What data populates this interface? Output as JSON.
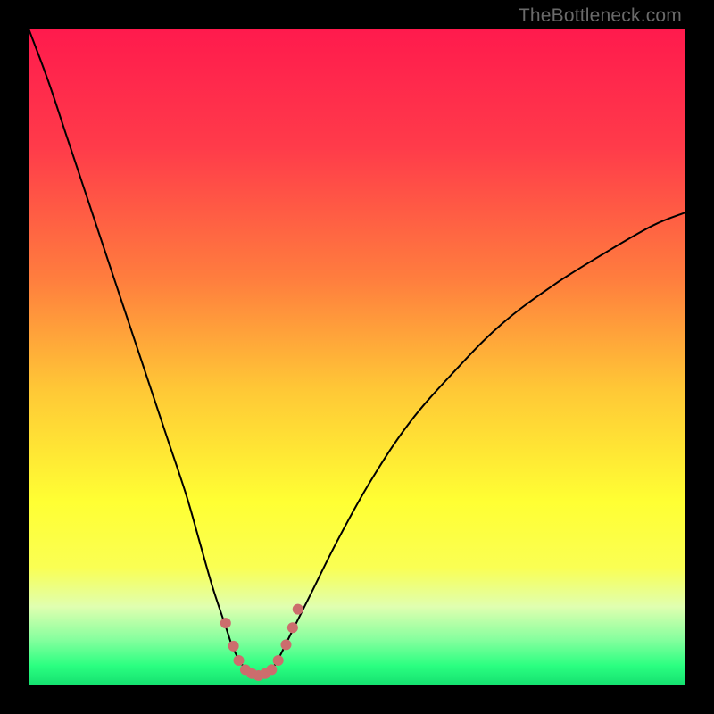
{
  "watermark": "TheBottleneck.com",
  "chart_data": {
    "type": "line",
    "title": "",
    "xlabel": "",
    "ylabel": "",
    "xlim": [
      0,
      100
    ],
    "ylim": [
      0,
      100
    ],
    "grid": false,
    "legend": false,
    "gradient_stops": [
      {
        "offset": 0.0,
        "color": "#ff1a4d"
      },
      {
        "offset": 0.18,
        "color": "#ff3b4a"
      },
      {
        "offset": 0.38,
        "color": "#ff7d3e"
      },
      {
        "offset": 0.55,
        "color": "#ffc836"
      },
      {
        "offset": 0.72,
        "color": "#ffff33"
      },
      {
        "offset": 0.82,
        "color": "#faff53"
      },
      {
        "offset": 0.88,
        "color": "#e0ffb0"
      },
      {
        "offset": 0.93,
        "color": "#86ff9e"
      },
      {
        "offset": 0.97,
        "color": "#2bff81"
      },
      {
        "offset": 1.0,
        "color": "#14e06f"
      }
    ],
    "series": [
      {
        "name": "bottleneck-curve",
        "color": "#000000",
        "width": 2.0,
        "x": [
          0,
          3,
          6,
          9,
          12,
          15,
          18,
          21,
          24,
          26,
          28,
          30,
          31,
          32,
          33,
          34,
          35,
          36,
          37,
          38,
          40,
          43,
          47,
          52,
          58,
          65,
          72,
          80,
          88,
          95,
          100
        ],
        "y": [
          100,
          92,
          83,
          74,
          65,
          56,
          47,
          38,
          29,
          22,
          15,
          9,
          6,
          4,
          2.5,
          1.8,
          1.5,
          1.8,
          2.5,
          4,
          8,
          14,
          22,
          31,
          40,
          48,
          55,
          61,
          66,
          70,
          72
        ]
      },
      {
        "name": "threshold-dots",
        "color": "#cc6d6d",
        "type": "scatter",
        "marker_radius_px": 6,
        "x": [
          30.0,
          31.2,
          32.0,
          33.0,
          34.0,
          35.0,
          36.0,
          37.0,
          38.0,
          39.2,
          40.2,
          41.0
        ],
        "y": [
          9.5,
          6.0,
          3.8,
          2.4,
          1.8,
          1.5,
          1.8,
          2.4,
          3.8,
          6.2,
          8.8,
          11.6
        ]
      }
    ]
  }
}
